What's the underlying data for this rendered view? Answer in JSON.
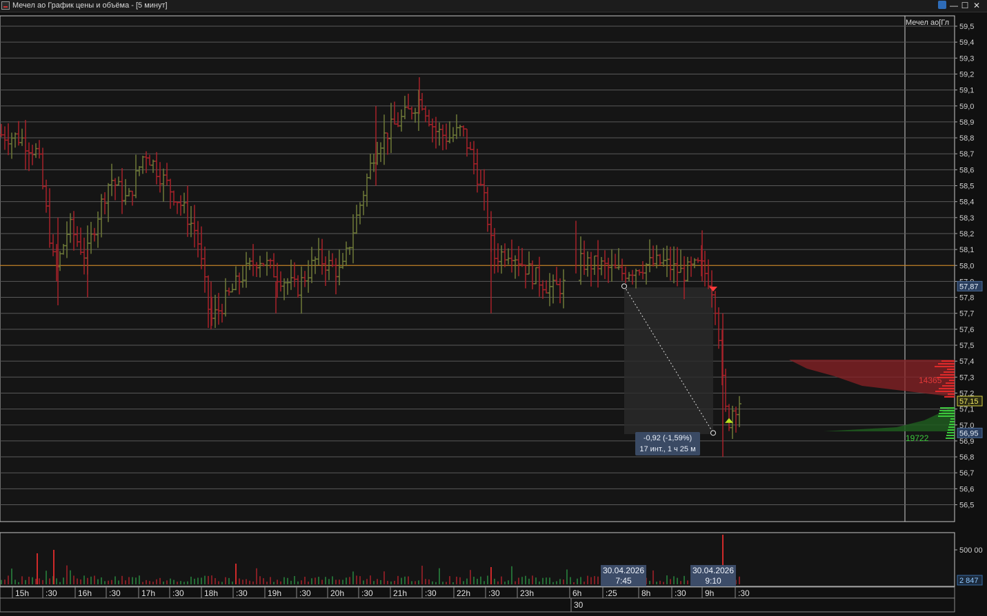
{
  "window": {
    "title": "Мечел ао График цены и объёма - [5 минут]",
    "buttons": [
      "—",
      "☐",
      "✕"
    ],
    "link_icon": "link-icon"
  },
  "chart_data": {
    "type": "ohlc",
    "instrument_label": "Мечел ао[Гл",
    "interval": "5 минут",
    "y_ticks": [
      "59,5",
      "59,4",
      "59,3",
      "59,2",
      "59,1",
      "59,0",
      "58,9",
      "58,8",
      "58,7",
      "58,6",
      "58,5",
      "58,4",
      "58,3",
      "58,2",
      "58,1",
      "58,0",
      "57,9",
      "57,8",
      "57,7",
      "57,6",
      "57,5",
      "57,4",
      "57,3",
      "57,2",
      "57,1",
      "57,0",
      "56,9",
      "56,8",
      "56,7",
      "56,6",
      "56,5"
    ],
    "ylim": [
      56.45,
      59.55
    ],
    "reference_line": 58.0,
    "colors": {
      "up": "#6e7a38",
      "down": "#a8222a",
      "reference": "#d98a1c",
      "grid": "#5a5a5a"
    },
    "price_tags": [
      {
        "label": "57,87",
        "value": 57.87,
        "style": "blue"
      },
      {
        "label": "57,15",
        "value": 57.15,
        "style": "yellow"
      },
      {
        "label": "56,95",
        "value": 56.95,
        "style": "blue"
      }
    ],
    "volume_profile": {
      "sell_label": "14365",
      "buy_label": "19722",
      "colors": {
        "sell": "#8a2226",
        "buy": "#1f5a1f"
      }
    },
    "measurement": {
      "line1": "-0,92 (-1,59%)",
      "line2": "17 инт., 1 ч 25 м",
      "from_price": 57.87,
      "to_price": 56.95
    },
    "markers": [
      {
        "kind": "sell-arrow",
        "price": 57.85
      },
      {
        "kind": "buy-arrow",
        "price": 57.03
      }
    ]
  },
  "volume_panel": {
    "tick_label": "500 00",
    "last_value": "2 847"
  },
  "time_axis": {
    "labels": [
      "15h",
      ":30",
      "16h",
      ":30",
      "17h",
      ":30",
      "18h",
      ":30",
      "19h",
      ":30",
      "20h",
      ":30",
      "21h",
      ":30",
      "22h",
      ":30",
      "23h",
      "6h",
      ":25",
      "8h",
      ":30",
      "9h",
      ":30"
    ],
    "second_row": "30",
    "cursor_dates": [
      {
        "date": "30.04.2026",
        "time": "7:45"
      },
      {
        "date": "30.04.2026",
        "time": "9:10"
      }
    ]
  }
}
